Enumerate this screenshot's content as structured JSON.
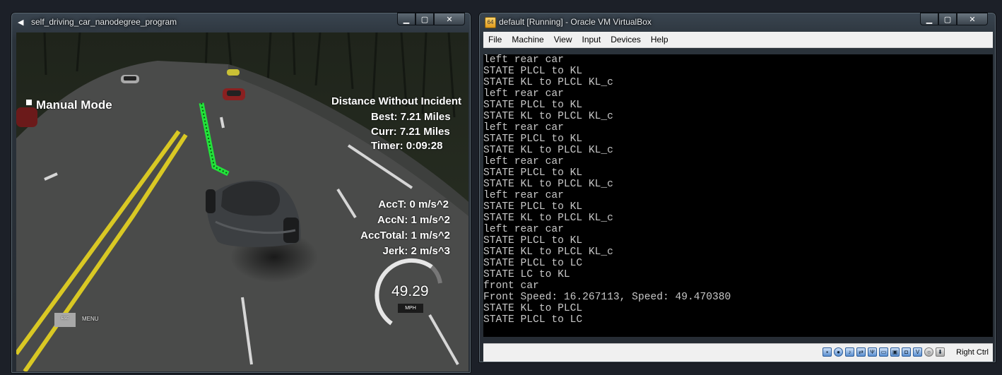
{
  "simulator": {
    "title": "self_driving_car_nanodegree_program",
    "mode_label": "Manual Mode",
    "distance_title": "Distance Without Incident",
    "best": "Best: 7.21 Miles",
    "curr": "Curr: 7.21 Miles",
    "timer": "Timer: 0:09:28",
    "acc_t": "AccT: 0 m/s^2",
    "acc_n": "AccN: 1 m/s^2",
    "acc_total": "AccTotal: 1 m/s^2",
    "jerk": "Jerk: 2 m/s^3",
    "speed": "49.29",
    "speed_unit": "MPH",
    "esc_key": "ESC",
    "menu_label": "MENU"
  },
  "vbox": {
    "title": "default [Running] - Oracle VM VirtualBox",
    "menu": [
      "File",
      "Machine",
      "View",
      "Input",
      "Devices",
      "Help"
    ],
    "console_lines": [
      "left rear car",
      "STATE PLCL to KL",
      "STATE KL to PLCL KL_c",
      "left rear car",
      "STATE PLCL to KL",
      "STATE KL to PLCL KL_c",
      "left rear car",
      "STATE PLCL to KL",
      "STATE KL to PLCL KL_c",
      "left rear car",
      "STATE PLCL to KL",
      "STATE KL to PLCL KL_c",
      "left rear car",
      "STATE PLCL to KL",
      "STATE KL to PLCL KL_c",
      "left rear car",
      "STATE PLCL to KL",
      "STATE KL to PLCL KL_c",
      "STATE PLCL to LC",
      "STATE LC to KL",
      "front car",
      "Front Speed: 16.267113, Speed: 49.470380",
      "STATE KL to PLCL",
      "STATE PLCL to LC"
    ],
    "host_key": "Right Ctrl"
  },
  "colors": {
    "path_green": "#22e23a",
    "lane_yellow": "#d9c824",
    "console_bg": "#000000",
    "console_text": "#c8c8c8"
  }
}
